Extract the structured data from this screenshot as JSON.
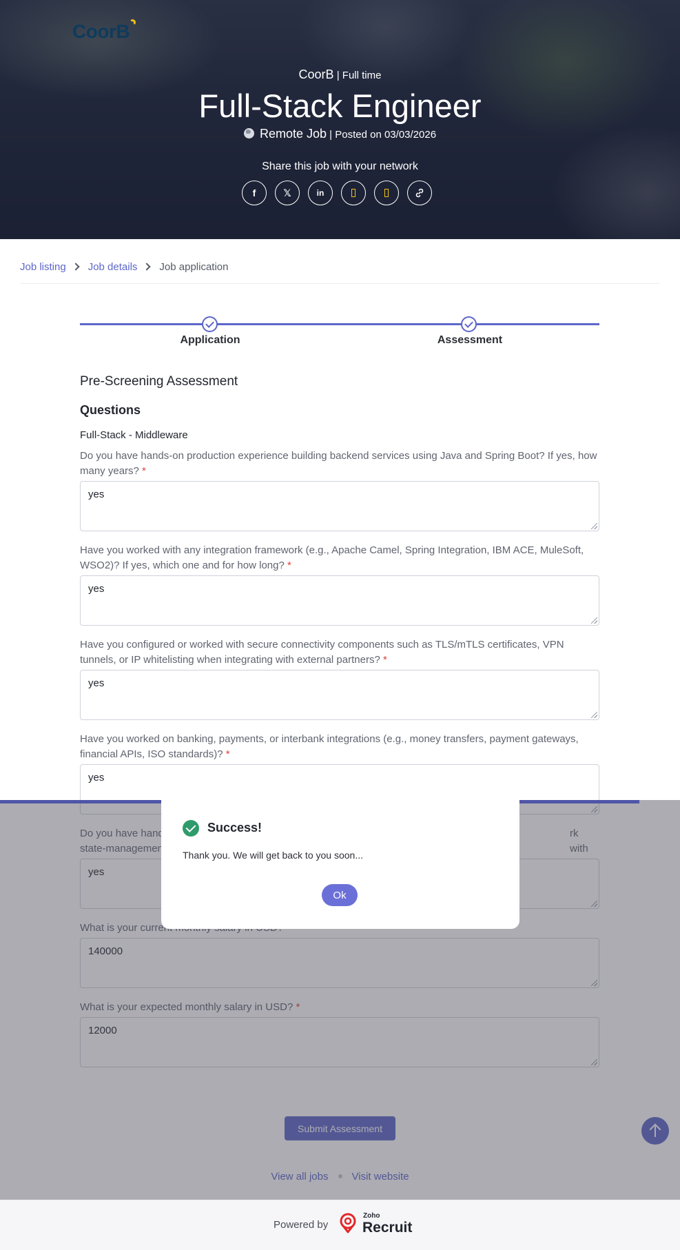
{
  "hero": {
    "logo": "CoorB",
    "company": "CoorB",
    "separator": " | ",
    "job_type": "Full time",
    "title": "Full-Stack Engineer",
    "location": "Remote Job",
    "posted": " | Posted on 03/03/2026",
    "share_text": "Share this job with your network",
    "share_icons": [
      "facebook-icon",
      "x-icon",
      "linkedin-icon",
      "share-icon",
      "share-icon",
      "link-icon"
    ]
  },
  "breadcrumb": {
    "items": [
      "Job listing",
      "Job details",
      "Job application"
    ]
  },
  "stepper": {
    "steps": [
      "Application",
      "Assessment"
    ]
  },
  "assessment": {
    "section_title": "Pre-Screening Assessment",
    "questions_title": "Questions",
    "group_title": "Full-Stack - Middleware",
    "required_marker": "*",
    "questions": [
      {
        "label": "Do you have hands-on production experience building backend services using Java and Spring Boot? If yes, how many years?",
        "value": "yes"
      },
      {
        "label": "Have you worked with any integration framework (e.g., Apache Camel, Spring Integration, IBM ACE, MuleSoft, WSO2)? If yes, which one and for how long?",
        "value": "yes"
      },
      {
        "label": "Have you configured or worked with secure connectivity components such as TLS/mTLS certificates, VPN tunnels, or IP whitelisting when integrating with external partners?",
        "value": "yes"
      },
      {
        "label": "Have you worked on banking, payments, or interbank integrations (e.g., money transfers, payment gateways, financial APIs, ISO standards)?",
        "value": "yes"
      },
      {
        "label_start": "Do you have hand",
        "label_end": "rk with any",
        "label_line2": "state-managemen",
        "value": "yes"
      },
      {
        "label": "What is your current monthly salary in USD?",
        "value": "140000"
      },
      {
        "label": "What is your expected monthly salary in USD?",
        "value": "12000"
      }
    ],
    "submit_label": "Submit Assessment"
  },
  "footer": {
    "view_all": "View all jobs",
    "visit": "Visit website",
    "powered_by": "Powered by",
    "zoho_small": "Zoho",
    "zoho_big": "Recruit"
  },
  "modal": {
    "title": "Success!",
    "message": "Thank you. We will get back to you soon...",
    "ok_label": "Ok"
  },
  "colors": {
    "accent": "#5d66c9",
    "success": "#2f9b6b",
    "required": "#e0403c"
  }
}
